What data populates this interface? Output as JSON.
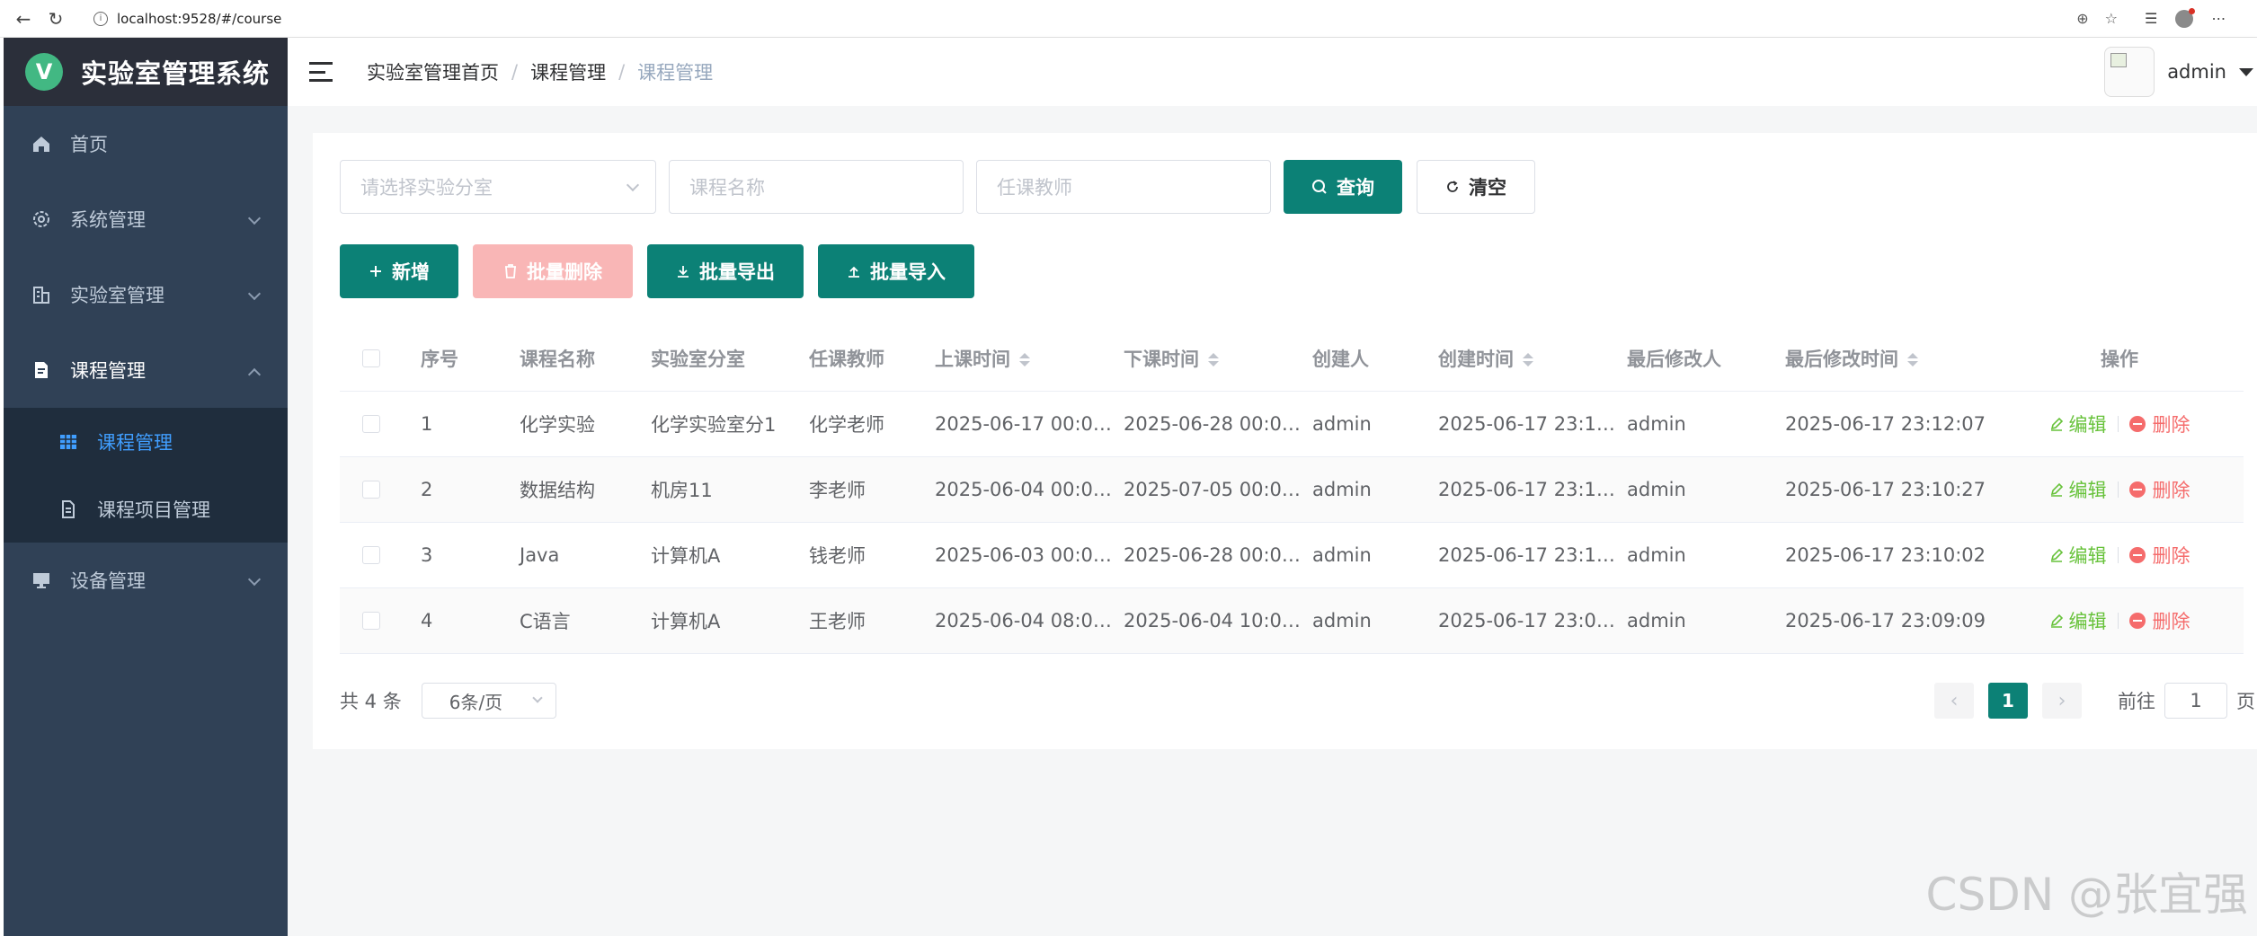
{
  "browser": {
    "url": "localhost:9528/#/course"
  },
  "app": {
    "logo_letter": "V",
    "title": "实验室管理系统"
  },
  "sidebar": {
    "items": [
      {
        "label": "首页",
        "icon": "home-icon"
      },
      {
        "label": "系统管理",
        "icon": "gear-icon"
      },
      {
        "label": "实验室管理",
        "icon": "building-icon"
      },
      {
        "label": "课程管理",
        "icon": "document-icon"
      },
      {
        "label": "设备管理",
        "icon": "monitor-icon"
      }
    ],
    "submenu": [
      {
        "label": "课程管理",
        "icon": "grid-icon",
        "active": true
      },
      {
        "label": "课程项目管理",
        "icon": "file-icon",
        "active": false
      }
    ]
  },
  "navbar": {
    "breadcrumb": [
      "实验室管理首页",
      "课程管理",
      "课程管理"
    ],
    "user": "admin"
  },
  "search": {
    "lab_placeholder": "请选择实验分室",
    "name_placeholder": "课程名称",
    "teacher_placeholder": "任课教师",
    "query_label": "查询",
    "clear_label": "清空"
  },
  "actions": {
    "add_label": "新增",
    "batch_delete_label": "批量删除",
    "batch_export_label": "批量导出",
    "batch_import_label": "批量导入"
  },
  "table": {
    "columns": {
      "index": "序号",
      "name": "课程名称",
      "lab": "实验室分室",
      "teacher": "任课教师",
      "start": "上课时间",
      "end": "下课时间",
      "creator": "创建人",
      "ctime": "创建时间",
      "modifier": "最后修改人",
      "mtime": "最后修改时间",
      "ops": "操作"
    },
    "edit_label": "编辑",
    "delete_label": "删除",
    "rows": [
      {
        "index": "1",
        "name": "化学实验",
        "lab": "化学实验室分1",
        "teacher": "化学老师",
        "start": "2025-06-17 00:0…",
        "end": "2025-06-28 00:0…",
        "creator": "admin",
        "ctime": "2025-06-17 23:1…",
        "modifier": "admin",
        "mtime": "2025-06-17 23:12:07"
      },
      {
        "index": "2",
        "name": "数据结构",
        "lab": "机房11",
        "teacher": "李老师",
        "start": "2025-06-04 00:0…",
        "end": "2025-07-05 00:0…",
        "creator": "admin",
        "ctime": "2025-06-17 23:1…",
        "modifier": "admin",
        "mtime": "2025-06-17 23:10:27"
      },
      {
        "index": "3",
        "name": "Java",
        "lab": "计算机A",
        "teacher": "钱老师",
        "start": "2025-06-03 00:0…",
        "end": "2025-06-28 00:0…",
        "creator": "admin",
        "ctime": "2025-06-17 23:1…",
        "modifier": "admin",
        "mtime": "2025-06-17 23:10:02"
      },
      {
        "index": "4",
        "name": "C语言",
        "lab": "计算机A",
        "teacher": "王老师",
        "start": "2025-06-04 08:0…",
        "end": "2025-06-04 10:0…",
        "creator": "admin",
        "ctime": "2025-06-17 23:0…",
        "modifier": "admin",
        "mtime": "2025-06-17 23:09:09"
      }
    ]
  },
  "pagination": {
    "total_text": "共 4 条",
    "page_size": "6条/页",
    "current_page": "1",
    "goto_prefix": "前往",
    "goto_value": "1",
    "goto_suffix": "页"
  },
  "watermark": "CSDN @张宜强",
  "colors": {
    "primary": "#0c8176",
    "sidebar": "#304156",
    "active": "#409eff",
    "success": "#67c23a",
    "danger": "#f56c6c"
  }
}
